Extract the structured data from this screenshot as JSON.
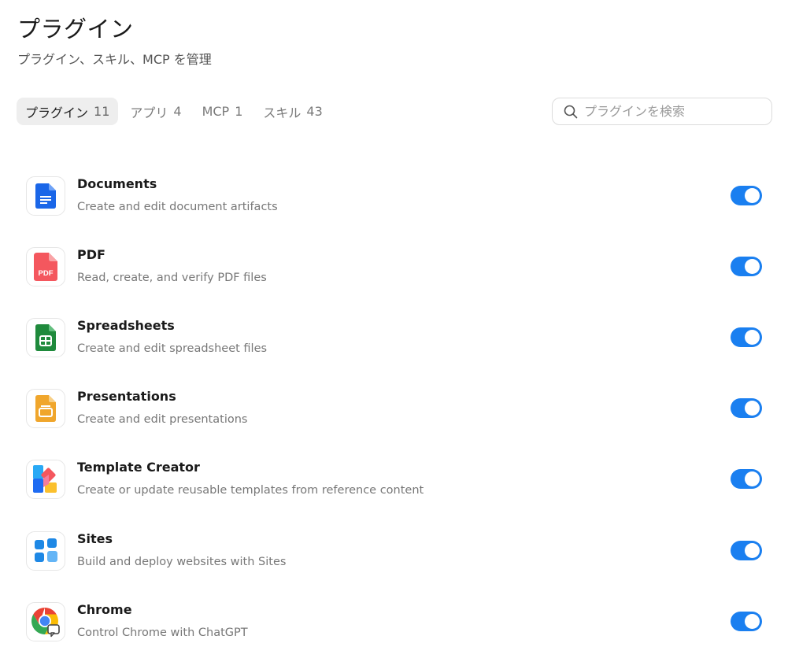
{
  "header": {
    "title": "プラグイン",
    "subtitle": "プラグイン、スキル、MCP を管理"
  },
  "tabs": [
    {
      "label": "プラグイン",
      "count": "11",
      "active": true
    },
    {
      "label": "アプリ",
      "count": "4",
      "active": false
    },
    {
      "label": "MCP",
      "count": "1",
      "active": false
    },
    {
      "label": "スキル",
      "count": "43",
      "active": false
    }
  ],
  "search": {
    "placeholder": "プラグインを検索",
    "value": ""
  },
  "plugins": [
    {
      "name": "Documents",
      "description": "Create and edit document artifacts",
      "icon": "documents-icon",
      "enabled": true
    },
    {
      "name": "PDF",
      "description": "Read, create, and verify PDF files",
      "icon": "pdf-icon",
      "icon_text": "PDF",
      "enabled": true
    },
    {
      "name": "Spreadsheets",
      "description": "Create and edit spreadsheet files",
      "icon": "spreadsheets-icon",
      "enabled": true
    },
    {
      "name": "Presentations",
      "description": "Create and edit presentations",
      "icon": "presentations-icon",
      "enabled": true
    },
    {
      "name": "Template Creator",
      "description": "Create or update reusable templates from reference content",
      "icon": "template-creator-icon",
      "enabled": true
    },
    {
      "name": "Sites",
      "description": "Build and deploy websites with Sites",
      "icon": "sites-icon",
      "enabled": true
    },
    {
      "name": "Chrome",
      "description": "Control Chrome with ChatGPT",
      "icon": "chrome-icon",
      "enabled": true
    }
  ],
  "colors": {
    "accent": "#1a7ff0",
    "documents": "#1a66e8",
    "pdf": "#f4575e",
    "spreadsheets": "#1f8a3c",
    "presentations": "#f0a62c"
  }
}
